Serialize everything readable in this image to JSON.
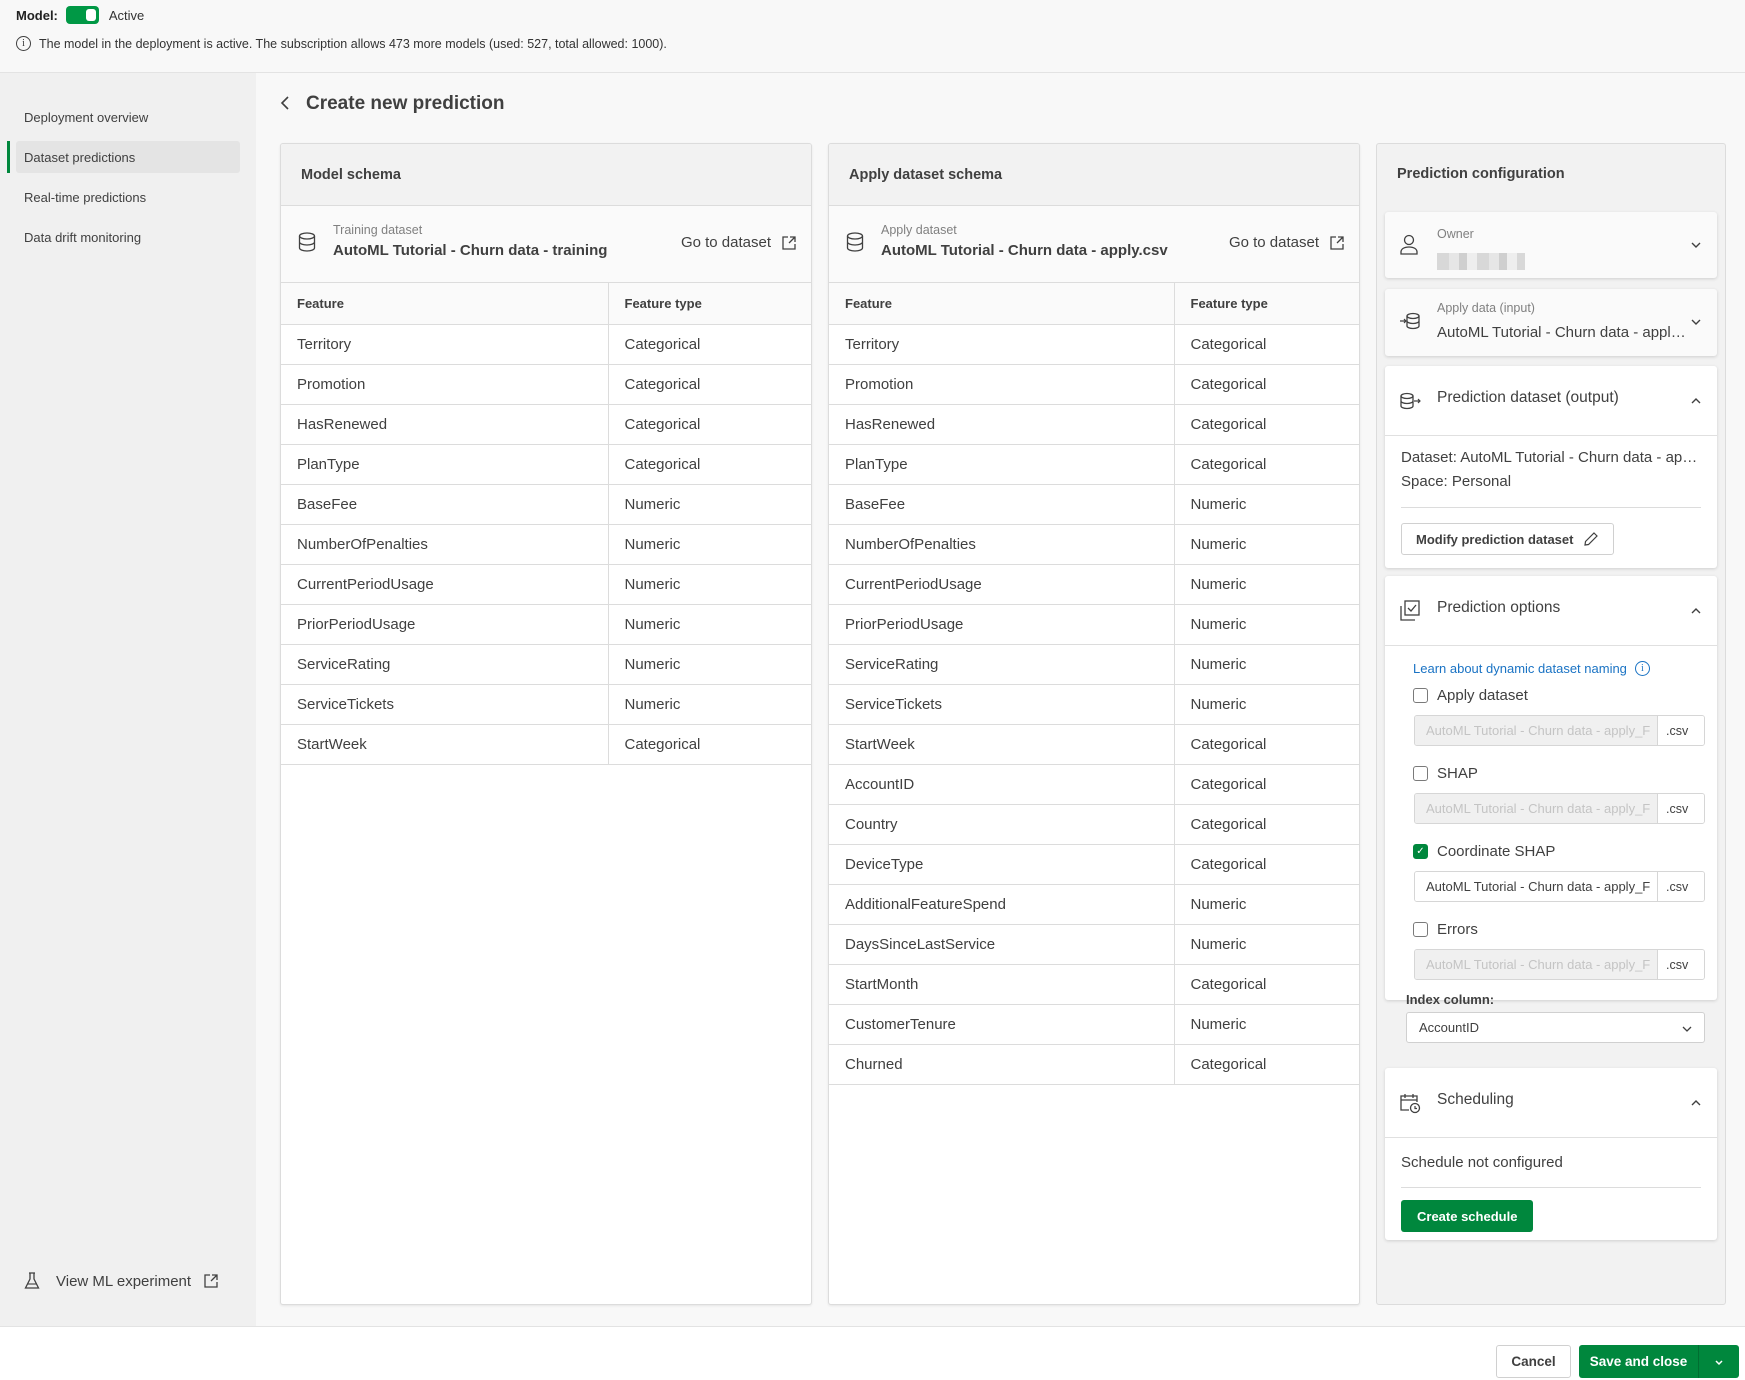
{
  "topbar": {
    "model_label": "Model:",
    "model_toggle_on": true,
    "model_status": "Active",
    "info_text": "The model in the deployment is active. The subscription allows 473 more models (used: 527, total allowed: 1000)."
  },
  "sidebar": {
    "items": [
      {
        "label": "Deployment overview",
        "active": false
      },
      {
        "label": "Dataset predictions",
        "active": true
      },
      {
        "label": "Real-time predictions",
        "active": false
      },
      {
        "label": "Data drift monitoring",
        "active": false
      }
    ],
    "view_experiment": "View ML experiment"
  },
  "page": {
    "title": "Create new prediction"
  },
  "model_schema": {
    "title": "Model schema",
    "dataset_caption": "Training dataset",
    "dataset_name": "AutoML Tutorial - Churn data - training",
    "goto_label": "Go to dataset",
    "columns": [
      "Feature",
      "Feature type"
    ],
    "rows": [
      [
        "Territory",
        "Categorical"
      ],
      [
        "Promotion",
        "Categorical"
      ],
      [
        "HasRenewed",
        "Categorical"
      ],
      [
        "PlanType",
        "Categorical"
      ],
      [
        "BaseFee",
        "Numeric"
      ],
      [
        "NumberOfPenalties",
        "Numeric"
      ],
      [
        "CurrentPeriodUsage",
        "Numeric"
      ],
      [
        "PriorPeriodUsage",
        "Numeric"
      ],
      [
        "ServiceRating",
        "Numeric"
      ],
      [
        "ServiceTickets",
        "Numeric"
      ],
      [
        "StartWeek",
        "Categorical"
      ]
    ]
  },
  "apply_schema": {
    "title": "Apply dataset schema",
    "dataset_caption": "Apply dataset",
    "dataset_name": "AutoML Tutorial - Churn data - apply.csv",
    "goto_label": "Go to dataset",
    "columns": [
      "Feature",
      "Feature type"
    ],
    "rows": [
      [
        "Territory",
        "Categorical"
      ],
      [
        "Promotion",
        "Categorical"
      ],
      [
        "HasRenewed",
        "Categorical"
      ],
      [
        "PlanType",
        "Categorical"
      ],
      [
        "BaseFee",
        "Numeric"
      ],
      [
        "NumberOfPenalties",
        "Numeric"
      ],
      [
        "CurrentPeriodUsage",
        "Numeric"
      ],
      [
        "PriorPeriodUsage",
        "Numeric"
      ],
      [
        "ServiceRating",
        "Numeric"
      ],
      [
        "ServiceTickets",
        "Numeric"
      ],
      [
        "StartWeek",
        "Categorical"
      ],
      [
        "AccountID",
        "Categorical"
      ],
      [
        "Country",
        "Categorical"
      ],
      [
        "DeviceType",
        "Categorical"
      ],
      [
        "AdditionalFeatureSpend",
        "Numeric"
      ],
      [
        "DaysSinceLastService",
        "Numeric"
      ],
      [
        "StartMonth",
        "Categorical"
      ],
      [
        "CustomerTenure",
        "Numeric"
      ],
      [
        "Churned",
        "Categorical"
      ]
    ]
  },
  "config": {
    "title": "Prediction configuration",
    "owner": {
      "caption": "Owner",
      "value": "(redacted)"
    },
    "apply_data": {
      "caption": "Apply data (input)",
      "value": "AutoML Tutorial - Churn data - apply.csv"
    },
    "prediction_dataset": {
      "label": "Prediction dataset (output)",
      "dataset_line": "Dataset: AutoML Tutorial - Churn data - apply_Predictions",
      "space_line": "Space: Personal",
      "modify_button": "Modify prediction dataset"
    },
    "prediction_options": {
      "label": "Prediction options",
      "learn_link": "Learn about dynamic dataset naming",
      "options": [
        {
          "label": "Apply dataset",
          "checked": false,
          "filename": "AutoML Tutorial - Churn data - apply_F",
          "ext": ".csv"
        },
        {
          "label": "SHAP",
          "checked": false,
          "filename": "AutoML Tutorial - Churn data - apply_F",
          "ext": ".csv"
        },
        {
          "label": "Coordinate SHAP",
          "checked": true,
          "filename": "AutoML Tutorial - Churn data - apply_F",
          "ext": ".csv"
        },
        {
          "label": "Errors",
          "checked": false,
          "filename": "AutoML Tutorial - Churn data - apply_F",
          "ext": ".csv"
        }
      ],
      "index_label": "Index column:",
      "index_value": "AccountID"
    },
    "scheduling": {
      "label": "Scheduling",
      "status": "Schedule not configured",
      "create_button": "Create schedule"
    }
  },
  "footer": {
    "cancel": "Cancel",
    "save": "Save and close"
  },
  "colors": {
    "accent_green": "#00873d",
    "link_blue": "#1a73c4"
  }
}
